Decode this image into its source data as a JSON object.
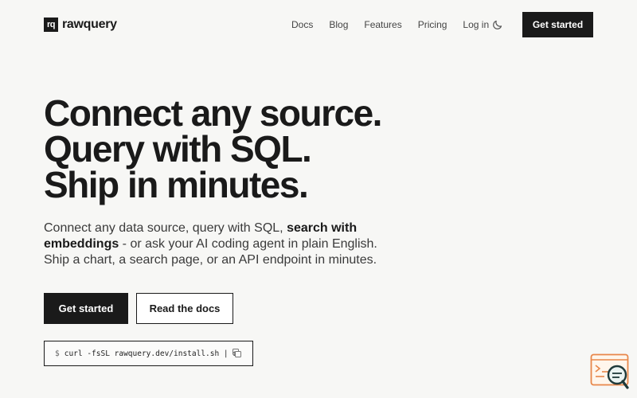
{
  "header": {
    "logo_mark": "rq",
    "logo_text": "rawquery",
    "nav": [
      "Docs",
      "Blog",
      "Features",
      "Pricing",
      "Log in"
    ],
    "theme_icon": "moon-icon",
    "cta": "Get started"
  },
  "hero": {
    "headline": [
      "Connect any source.",
      "Query with SQL.",
      "Ship in minutes."
    ],
    "sub_before": "Connect any data source, query with SQL, ",
    "sub_bold": "search with embeddings",
    "sub_after": " - or ask your AI coding agent in plain English. Ship a chart, a search page, or an API endpoint in minutes.",
    "primary_cta": "Get started",
    "secondary_cta": "Read the docs",
    "install_prompt": "$",
    "install_command": "curl -fsSL rawquery.dev/install.sh | sh",
    "copy_icon": "copy-icon"
  },
  "widget": {
    "icon": "chat-search-icon"
  }
}
